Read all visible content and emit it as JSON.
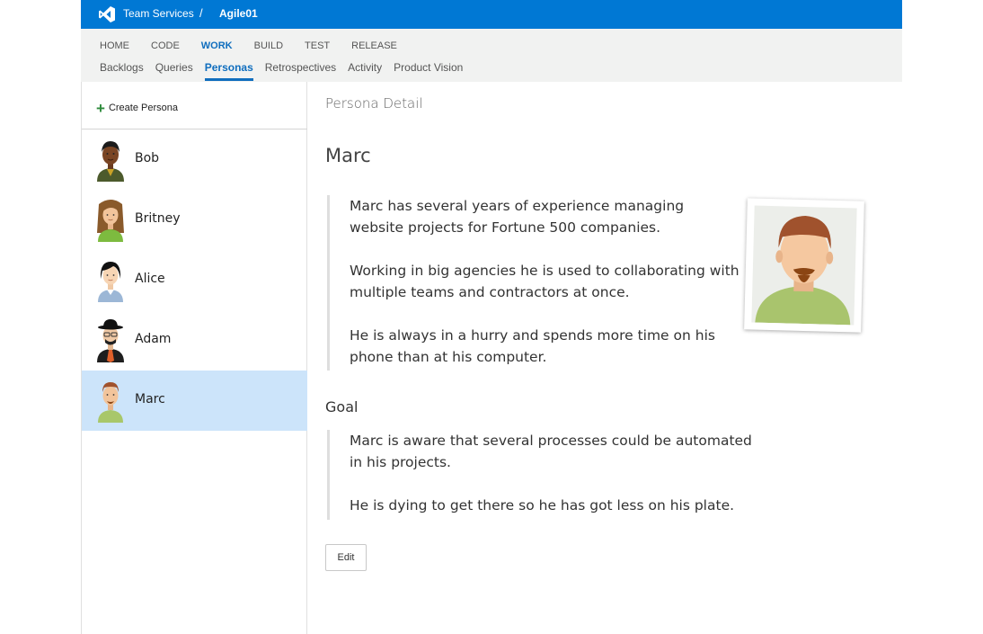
{
  "header": {
    "account": "Team Services",
    "separator": "/",
    "project": "Agile01",
    "logo_icon": "visual-studio-logo",
    "brand_color": "#0078d4"
  },
  "hubs": [
    {
      "label": "HOME",
      "active": false
    },
    {
      "label": "CODE",
      "active": false
    },
    {
      "label": "WORK",
      "active": true
    },
    {
      "label": "BUILD",
      "active": false
    },
    {
      "label": "TEST",
      "active": false
    },
    {
      "label": "RELEASE",
      "active": false
    }
  ],
  "subhubs": [
    {
      "label": "Backlogs",
      "active": false
    },
    {
      "label": "Queries",
      "active": false
    },
    {
      "label": "Personas",
      "active": true
    },
    {
      "label": "Retrospectives",
      "active": false
    },
    {
      "label": "Activity",
      "active": false
    },
    {
      "label": "Product Vision",
      "active": false
    }
  ],
  "sidebar": {
    "create_label": "Create Persona",
    "create_icon": "plus-icon",
    "personas": [
      {
        "name": "Bob",
        "avatar": "bob-avatar-icon",
        "selected": false
      },
      {
        "name": "Britney",
        "avatar": "britney-avatar-icon",
        "selected": false
      },
      {
        "name": "Alice",
        "avatar": "alice-avatar-icon",
        "selected": false
      },
      {
        "name": "Adam",
        "avatar": "adam-avatar-icon",
        "selected": false
      },
      {
        "name": "Marc",
        "avatar": "marc-avatar-icon",
        "selected": true
      }
    ]
  },
  "detail": {
    "section_title": "Persona Detail",
    "name": "Marc",
    "description": [
      "Marc has several years of experience managing website projects for Fortune 500 companies.",
      "Working in big agencies he is used to collaborating with multiple teams and contractors at once.",
      "He is always in a hurry and spends more time on his phone than at his computer."
    ],
    "goal_heading": "Goal",
    "goal": [
      "Marc is aware that several processes could be automated in his projects.",
      "He is dying to get there so he has got less on his plate."
    ],
    "edit_label": "Edit",
    "photo_icon": "marc-portrait-icon"
  }
}
